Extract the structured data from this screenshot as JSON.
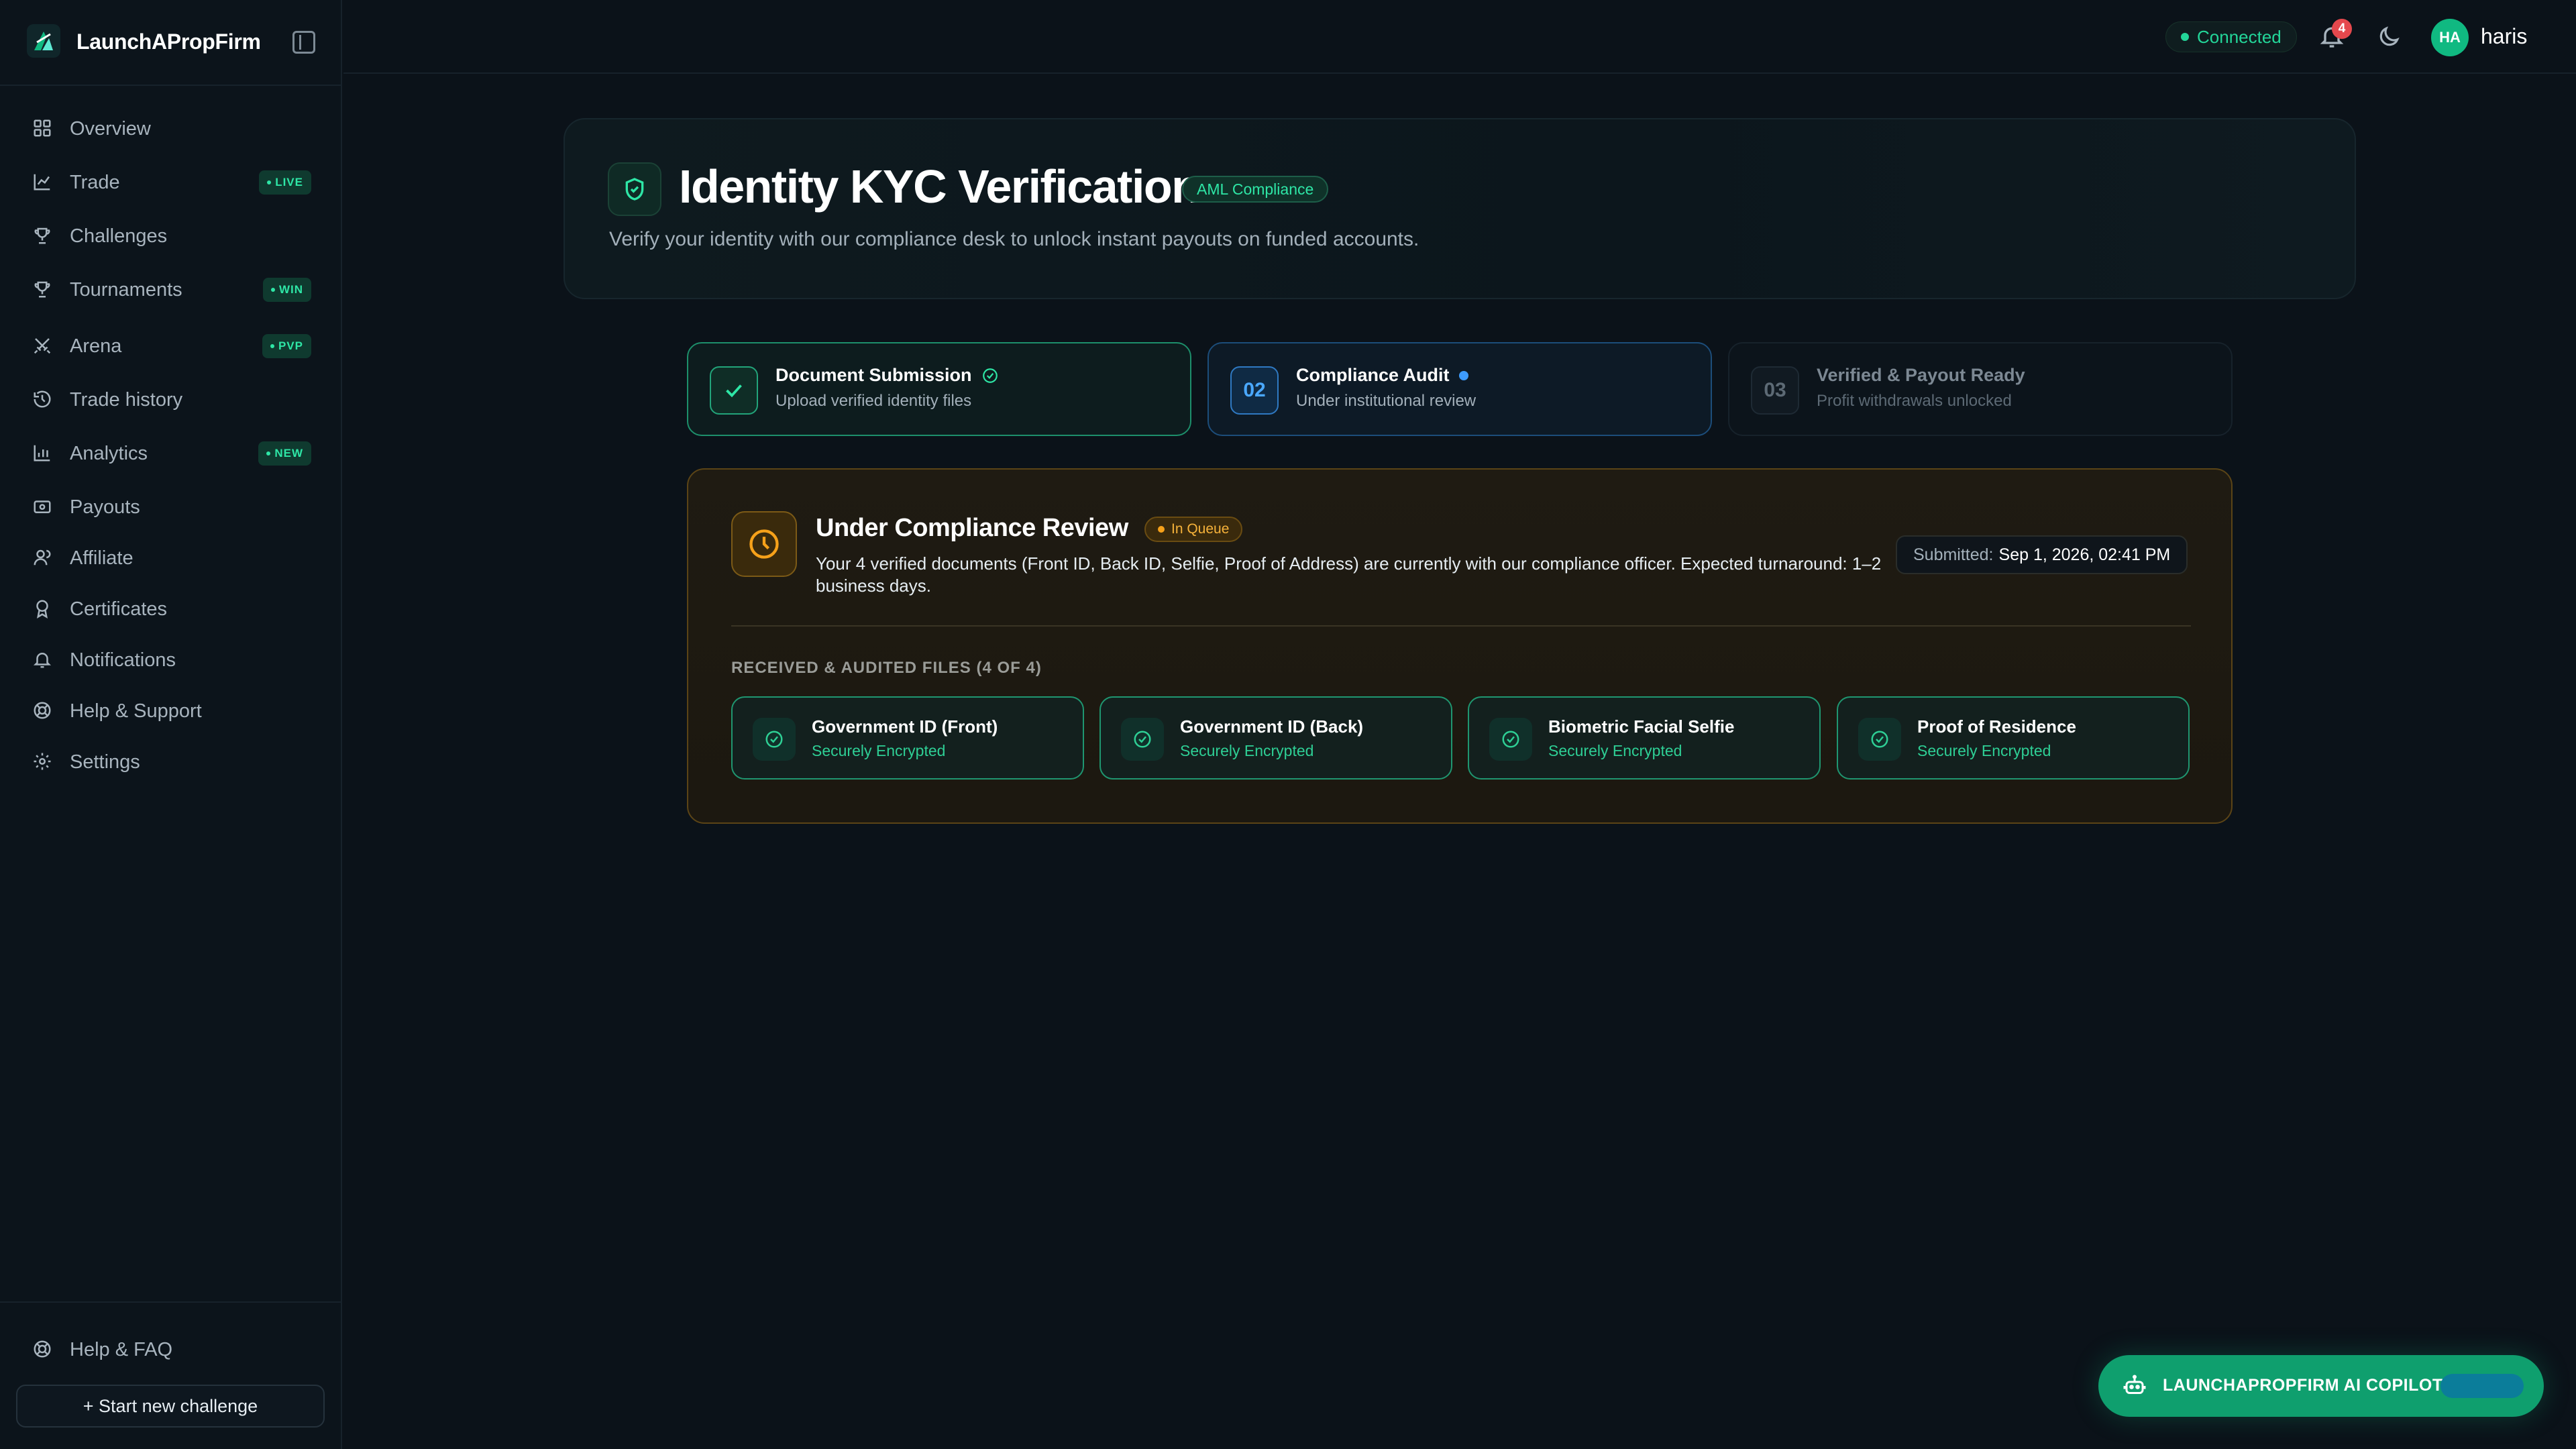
{
  "brand": {
    "name": "LaunchAPropFirm"
  },
  "sidebar": {
    "items": [
      {
        "label": "Overview",
        "icon": "grid-icon",
        "badge": ""
      },
      {
        "label": "Trade",
        "icon": "chart-icon",
        "badge": "LIVE"
      },
      {
        "label": "Challenges",
        "icon": "trophy-icon",
        "badge": ""
      },
      {
        "label": "Tournaments",
        "icon": "trophy-icon",
        "badge": "WIN"
      },
      {
        "label": "Arena",
        "icon": "swords-icon",
        "badge": "PVP"
      },
      {
        "label": "Trade history",
        "icon": "history-icon",
        "badge": ""
      },
      {
        "label": "Analytics",
        "icon": "bar-chart-icon",
        "badge": "NEW"
      },
      {
        "label": "Payouts",
        "icon": "wallet-icon",
        "badge": ""
      },
      {
        "label": "Affiliate",
        "icon": "users-icon",
        "badge": ""
      },
      {
        "label": "Certificates",
        "icon": "award-icon",
        "badge": ""
      },
      {
        "label": "Notifications",
        "icon": "bell-icon",
        "badge": ""
      },
      {
        "label": "Help & Support",
        "icon": "lifebuoy-icon",
        "badge": ""
      },
      {
        "label": "Settings",
        "icon": "gear-icon",
        "badge": ""
      }
    ],
    "footer": {
      "faq_label": "Help & FAQ",
      "start_label": "+ Start new challenge"
    }
  },
  "topbar": {
    "status": "Connected",
    "notifications_count": "4",
    "user_initials": "HA",
    "username": "haris"
  },
  "hero": {
    "title": "Identity KYC Verification",
    "badge": "AML Compliance",
    "subtitle": "Verify your identity with our compliance desk to unlock instant payouts on funded accounts."
  },
  "steps": [
    {
      "number": "",
      "title": "Document Submission",
      "subtitle": "Upload verified identity files",
      "state": "complete"
    },
    {
      "number": "02",
      "title": "Compliance Audit",
      "subtitle": "Under institutional review",
      "state": "active"
    },
    {
      "number": "03",
      "title": "Verified & Payout Ready",
      "subtitle": "Profit withdrawals unlocked",
      "state": "pending"
    }
  ],
  "review": {
    "title": "Under Compliance Review",
    "badge": "In Queue",
    "description": "Your 4 verified documents (Front ID, Back ID, Selfie, Proof of Address) are currently with our compliance officer. Expected turnaround: 1–2 business days.",
    "submitted_label": "Submitted:",
    "submitted_value": "Sep 1, 2026, 02:41 PM",
    "files_heading": "RECEIVED & AUDITED FILES (4 OF 4)",
    "files": [
      {
        "name": "Government ID (Front)",
        "status": "Securely Encrypted"
      },
      {
        "name": "Government ID (Back)",
        "status": "Securely Encrypted"
      },
      {
        "name": "Biometric Facial Selfie",
        "status": "Securely Encrypted"
      },
      {
        "name": "Proof of Residence",
        "status": "Securely Encrypted"
      }
    ]
  },
  "copilot": {
    "label": "LAUNCHAPROPFIRM AI COPILOT"
  },
  "colors": {
    "accent": "#10b981",
    "background": "#0b1219",
    "warning": "#f6a11a",
    "info": "#3d9cff",
    "danger": "#e5484d"
  }
}
